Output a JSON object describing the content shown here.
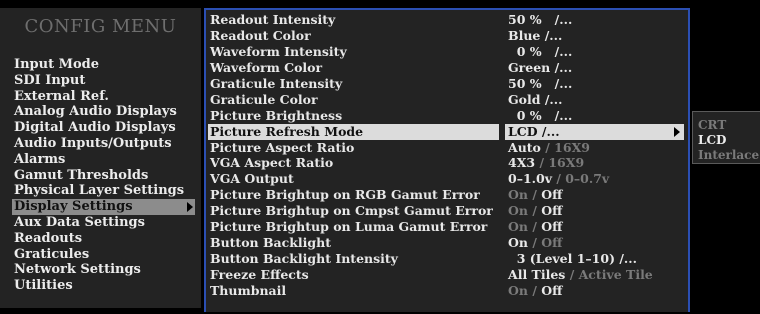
{
  "menu": {
    "title": "CONFIG MENU",
    "items": [
      {
        "label": "Input Mode"
      },
      {
        "label": "SDI Input"
      },
      {
        "label": "External Ref."
      },
      {
        "label": "Analog Audio Displays"
      },
      {
        "label": "Digital Audio Displays"
      },
      {
        "label": "Audio Inputs/Outputs"
      },
      {
        "label": "Alarms"
      },
      {
        "label": "Gamut Thresholds"
      },
      {
        "label": "Physical Layer Settings"
      },
      {
        "label": "Display Settings",
        "selected": true
      },
      {
        "label": "Aux Data Settings"
      },
      {
        "label": "Readouts"
      },
      {
        "label": "Graticules"
      },
      {
        "label": "Network Settings"
      },
      {
        "label": "Utilities"
      }
    ]
  },
  "settings": {
    "rows": [
      {
        "label": "Readout Intensity",
        "value": "50 %   /..."
      },
      {
        "label": "Readout Color",
        "value": "Blue /..."
      },
      {
        "label": "Waveform Intensity",
        "value": "  0 %   /..."
      },
      {
        "label": "Waveform Color",
        "value": "Green /..."
      },
      {
        "label": "Graticule Intensity",
        "value": "50 %   /..."
      },
      {
        "label": "Graticule Color",
        "value": "Gold /..."
      },
      {
        "label": "Picture Brightness",
        "value": "  0 %   /..."
      },
      {
        "label": "Picture Refresh Mode",
        "value": "LCD /...",
        "selected": true
      },
      {
        "label": "Picture Aspect Ratio",
        "on": "Auto",
        "off": " / 16X9"
      },
      {
        "label": "VGA Aspect Ratio",
        "on": "4X3",
        "off": " / 16X9"
      },
      {
        "label": "VGA Output",
        "on": "0–1.0v",
        "off": " / 0–0.7v"
      },
      {
        "label": "Picture Brightup on RGB Gamut Error",
        "off_first": "On / ",
        "on_last": "Off"
      },
      {
        "label": "Picture Brightup on Cmpst Gamut Error",
        "off_first": "On / ",
        "on_last": "Off"
      },
      {
        "label": "Picture Brightup on Luma Gamut Error",
        "off_first": "On / ",
        "on_last": "Off"
      },
      {
        "label": "Button Backlight",
        "on": "On",
        "off": " / Off"
      },
      {
        "label": "Button Backlight Intensity",
        "value": "  3 (Level 1–10) /..."
      },
      {
        "label": "Freeze Effects",
        "on": "All Tiles",
        "off": " / Active Tile"
      },
      {
        "label": "Thumbnail",
        "off_first": "On / ",
        "on_last": "Off"
      }
    ]
  },
  "submenu": {
    "items": [
      {
        "label": "CRT",
        "active": false
      },
      {
        "label": "LCD",
        "active": true
      },
      {
        "label": "Interlace",
        "active": false
      }
    ]
  },
  "colors": {
    "panel_bg": "#232323",
    "border_accent": "#2b4fb3",
    "highlight": "#dcdcdc",
    "menu_highlight": "#8c8c8c",
    "dim_text": "#7a7a7a"
  }
}
